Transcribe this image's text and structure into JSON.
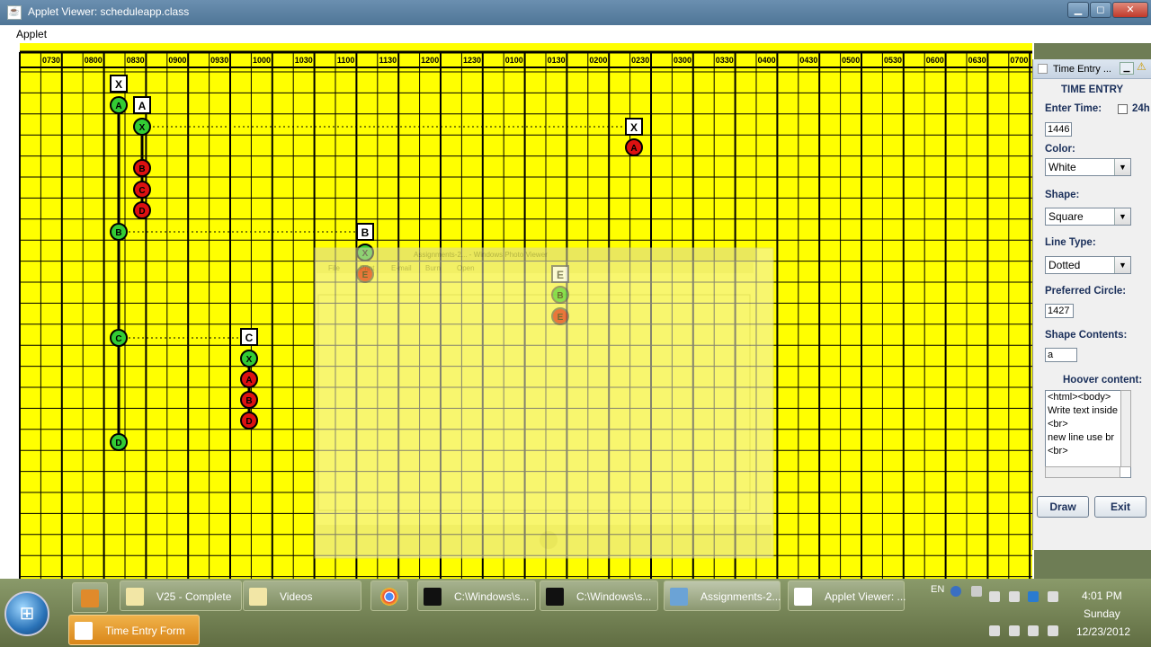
{
  "window": {
    "title": "Applet Viewer: scheduleapp.class",
    "menu": "Applet",
    "buttons": {
      "minimize": "▁",
      "maximize": "◻",
      "close": "✕"
    }
  },
  "schedule": {
    "time_labels": [
      "0730",
      "0800",
      "0830",
      "0900",
      "0930",
      "1000",
      "1030",
      "1100",
      "1130",
      "1200",
      "1230",
      "0100",
      "0130",
      "0200",
      "0230",
      "0300",
      "0330",
      "0400",
      "0430",
      "0500",
      "0530",
      "0600",
      "0630",
      "0700"
    ],
    "colors": {
      "grid_bg": "#ffff00",
      "green_node": "#33cc33",
      "red_node": "#dd1111",
      "grid_line": "#000000"
    },
    "square_labels": {
      "top_x": "X",
      "top_a": "A",
      "right_x": "X",
      "mid_b": "B",
      "mid_c": "C",
      "faded_e": "E"
    },
    "circle_labels": {
      "A": "A",
      "B": "B",
      "C": "C",
      "D": "D",
      "X": "X",
      "E": "E"
    }
  },
  "overlay_window": {
    "title": "Assignments-2... - Windows Photo Viewer",
    "menu": [
      "File",
      "Print",
      "E-mail",
      "Burn",
      "Open"
    ]
  },
  "time_entry": {
    "title": "Time Entry ...",
    "heading": "TIME ENTRY",
    "enter_time_label": "Enter Time:",
    "checkbox_label": "24h",
    "time_value": "1446",
    "color_label": "Color:",
    "color_value": "White",
    "shape_label": "Shape:",
    "shape_value": "Square",
    "line_type_label": "Line Type:",
    "line_type_value": "Dotted",
    "preferred_circle_label": "Preferred Circle:",
    "preferred_circle_value": "1427",
    "shape_contents_label": "Shape Contents:",
    "shape_contents_value": "a",
    "hover_content_label": "Hoover content:",
    "hover_lines": [
      "<html><body>",
      "Write text inside",
      "<br>",
      "new line use br",
      "<br>"
    ],
    "draw_label": "Draw",
    "exit_label": "Exit"
  },
  "taskbar": {
    "items": [
      {
        "label": "V25 - Complete",
        "icon": "folder-icon"
      },
      {
        "label": "Videos",
        "icon": "folder-icon"
      },
      {
        "label": "C:\\Windows\\s...",
        "icon": "cmd-icon"
      },
      {
        "label": "C:\\Windows\\s...",
        "icon": "cmd-icon"
      },
      {
        "label": "Assignments-2...",
        "icon": "photo-viewer-icon"
      },
      {
        "label": "Applet Viewer: ...",
        "icon": "java-icon"
      },
      {
        "label": "Time Entry Form",
        "icon": "java-icon"
      }
    ],
    "language": "EN",
    "clock": {
      "time": "4:01 PM",
      "day": "Sunday",
      "date": "12/23/2012"
    }
  }
}
